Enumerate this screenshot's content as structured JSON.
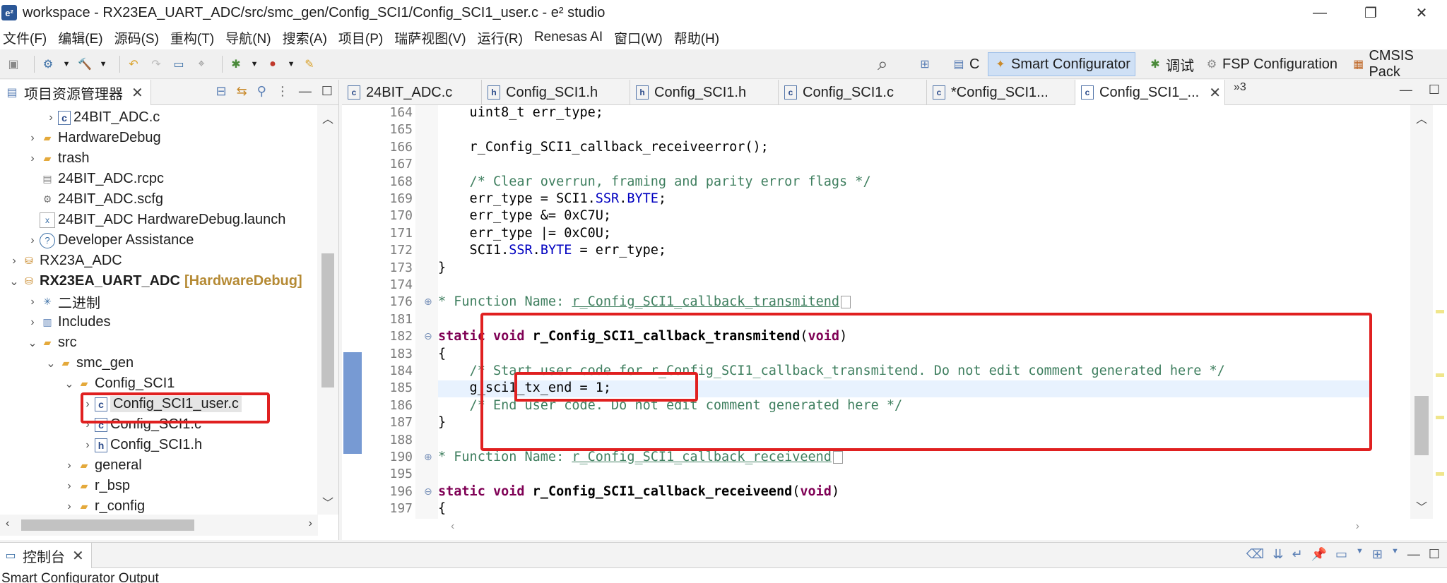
{
  "window": {
    "title": "workspace - RX23EA_UART_ADC/src/smc_gen/Config_SCI1/Config_SCI1_user.c - e² studio",
    "app_icon": "e²",
    "minimize": "—",
    "maximize": "❐",
    "close": "✕"
  },
  "menu": [
    "文件(F)",
    "编辑(E)",
    "源码(S)",
    "重构(T)",
    "导航(N)",
    "搜索(A)",
    "项目(P)",
    "瑞萨视图(V)",
    "运行(R)",
    "Renesas AI",
    "窗口(W)",
    "帮助(H)"
  ],
  "perspectives": {
    "c": "C",
    "smart_configurator": "Smart Configurator",
    "debug": "调试",
    "fsp": "FSP Configuration",
    "cmsis": "CMSIS Pack"
  },
  "project_explorer": {
    "tab_label": "项目资源管理器",
    "close": "✕",
    "items": [
      {
        "label": "24BIT_ADC.c"
      },
      {
        "label": "HardwareDebug"
      },
      {
        "label": "trash"
      },
      {
        "label": "24BIT_ADC.rcpc"
      },
      {
        "label": "24BIT_ADC.scfg"
      },
      {
        "label": "24BIT_ADC HardwareDebug.launch"
      },
      {
        "label": "Developer Assistance"
      },
      {
        "label": "RX23A_ADC"
      },
      {
        "label": "RX23EA_UART_ADC",
        "tag": "[HardwareDebug]"
      },
      {
        "label": "二进制"
      },
      {
        "label": "Includes"
      },
      {
        "label": "src"
      },
      {
        "label": "smc_gen"
      },
      {
        "label": "Config_SCI1"
      },
      {
        "label": "Config_SCI1_user.c"
      },
      {
        "label": "Config_SCI1.c"
      },
      {
        "label": "Config_SCI1.h"
      },
      {
        "label": "general"
      },
      {
        "label": "r_bsp"
      },
      {
        "label": "r_config"
      }
    ]
  },
  "editor": {
    "tabs": [
      {
        "label": "24BIT_ADC.c",
        "type": "c"
      },
      {
        "label": "Config_SCI1.h",
        "type": "h"
      },
      {
        "label": "Config_SCI1.h",
        "type": "h"
      },
      {
        "label": "Config_SCI1.c",
        "type": "c"
      },
      {
        "label": "*Config_SCI1...",
        "type": "c"
      },
      {
        "label": "Config_SCI1_...",
        "type": "c"
      }
    ],
    "more_tabs": "»3",
    "close": "✕",
    "lines": [
      {
        "n": "164",
        "t": "    uint8_t err_type;"
      },
      {
        "n": "165",
        "t": ""
      },
      {
        "n": "166",
        "t": "    r_Config_SCI1_callback_receiveerror();"
      },
      {
        "n": "167",
        "t": ""
      },
      {
        "n": "168",
        "t": "    /* Clear overrun, framing and parity error flags */"
      },
      {
        "n": "169",
        "t_pre": "    err_type = SCI1.",
        "t_mid": "SSR",
        "t_dot": ".",
        "t_mid2": "BYTE",
        "t_post": ";"
      },
      {
        "n": "170",
        "t": "    err_type &= 0xC7U;"
      },
      {
        "n": "171",
        "t": "    err_type |= 0xC0U;"
      },
      {
        "n": "172",
        "t_pre": "    SCI1.",
        "t_mid": "SSR",
        "t_dot": ".",
        "t_mid2": "BYTE",
        "t_post": " = err_type;"
      },
      {
        "n": "173",
        "t": "}"
      },
      {
        "n": "174",
        "t": ""
      },
      {
        "n": "176",
        "t_pre": "* Function Name: ",
        "t_mid": "r_Config_SCI1_callback_transmitend"
      },
      {
        "n": "181",
        "t": ""
      },
      {
        "n": "182",
        "kw1": "static",
        "kw2": "void",
        "fn": "r_Config_SCI1_callback_transmitend",
        "kw3": "void"
      },
      {
        "n": "183",
        "t": "{"
      },
      {
        "n": "184",
        "t": "    /* Start user code for r_Config_SCI1_callback_transmitend. Do not edit comment generated here */"
      },
      {
        "n": "185",
        "t": "    g_sci1_tx_end = 1;"
      },
      {
        "n": "186",
        "t": "    /* End user code. Do not edit comment generated here */"
      },
      {
        "n": "187",
        "t": "}"
      },
      {
        "n": "188",
        "t": ""
      },
      {
        "n": "190",
        "t_pre": "* Function Name: ",
        "t_mid": "r_Config_SCI1_callback_receiveend"
      },
      {
        "n": "195",
        "t": ""
      },
      {
        "n": "196",
        "kw1": "static",
        "kw2": "void",
        "fn": "r_Config_SCI1_callback_receiveend",
        "kw3": "void"
      },
      {
        "n": "197",
        "t": "{"
      }
    ]
  },
  "console": {
    "tab_label": "控制台",
    "close": "✕",
    "output_title": "Smart Configurator Output"
  },
  "colors": {
    "highlight_red": "#e02020",
    "keyword": "#7f0055",
    "comment": "#3f7f5f",
    "active_perspective": "#cfe0f5"
  }
}
